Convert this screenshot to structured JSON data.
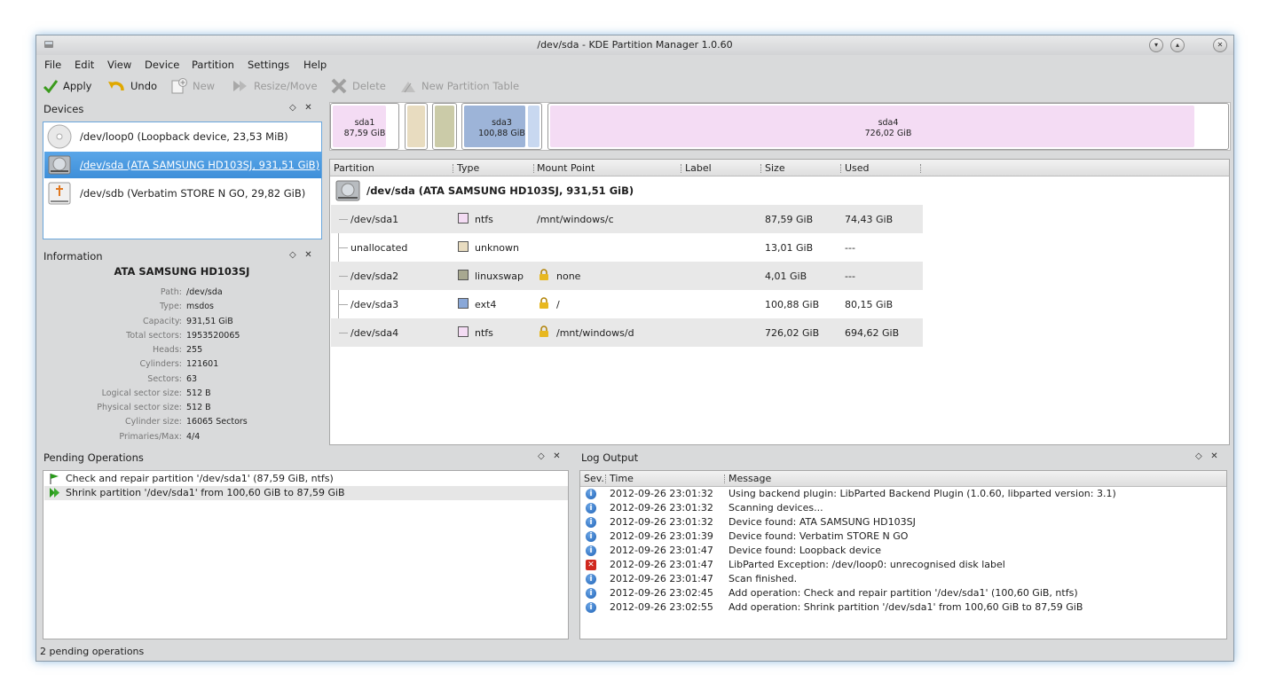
{
  "window": {
    "title": "/dev/sda - KDE Partition Manager 1.0.60"
  },
  "menu": [
    "File",
    "Edit",
    "View",
    "Device",
    "Partition",
    "Settings",
    "Help"
  ],
  "toolbar": {
    "apply": "Apply",
    "undo": "Undo",
    "new": "New",
    "resize": "Resize/Move",
    "delete": "Delete",
    "new_table": "New Partition Table"
  },
  "devices_panel": {
    "title": "Devices",
    "items": [
      {
        "label": "/dev/loop0 (Loopback device, 23,53 MiB)",
        "icon": "cdrom-icon"
      },
      {
        "label": "/dev/sda (ATA SAMSUNG HD103SJ, 931,51 GiB)",
        "icon": "harddisk-icon",
        "selected": true
      },
      {
        "label": "/dev/sdb (Verbatim STORE N GO, 29,82 GiB)",
        "icon": "usb-drive-icon"
      }
    ]
  },
  "info_panel": {
    "title": "Information",
    "heading": "ATA SAMSUNG HD103SJ",
    "rows": [
      {
        "k": "Path:",
        "v": "/dev/sda"
      },
      {
        "k": "Type:",
        "v": "msdos"
      },
      {
        "k": "Capacity:",
        "v": "931,51 GiB"
      },
      {
        "k": "Total sectors:",
        "v": "1953520065"
      },
      {
        "k": "Heads:",
        "v": "255"
      },
      {
        "k": "Cylinders:",
        "v": "121601"
      },
      {
        "k": "Sectors:",
        "v": "63"
      },
      {
        "k": "Logical sector size:",
        "v": "512 B"
      },
      {
        "k": "Physical sector size:",
        "v": "512 B"
      },
      {
        "k": "Cylinder size:",
        "v": "16065 Sectors"
      },
      {
        "k": "Primaries/Max:",
        "v": "4/4"
      }
    ]
  },
  "partition_bar": [
    {
      "name": "sda1",
      "size": "87,59 GiB",
      "fs": "ntfs",
      "color": "#f4dcf4"
    },
    {
      "name": "",
      "size": "",
      "fs": "unknown",
      "color": "#e8dcc0"
    },
    {
      "name": "",
      "size": "",
      "fs": "linuxswap",
      "color": "#c8c8a8"
    },
    {
      "name": "sda3",
      "size": "100,88 GiB",
      "fs": "ext4",
      "color": "#9db4d8"
    },
    {
      "name": "sda4",
      "size": "726,02 GiB",
      "fs": "ntfs",
      "color": "#f4dcf4"
    }
  ],
  "partition_table": {
    "headers": [
      "Partition",
      "Type",
      "Mount Point",
      "Label",
      "Size",
      "Used"
    ],
    "device": "/dev/sda (ATA SAMSUNG HD103SJ, 931,51 GiB)",
    "rows": [
      {
        "partition": "/dev/sda1",
        "type": "ntfs",
        "type_color": "#f4dcf4",
        "mount": "/mnt/windows/c",
        "locked": false,
        "label": "",
        "size": "87,59 GiB",
        "used": "74,43 GiB"
      },
      {
        "partition": "unallocated",
        "type": "unknown",
        "type_color": "#e8dcc0",
        "mount": "",
        "locked": false,
        "label": "",
        "size": "13,01 GiB",
        "used": "---"
      },
      {
        "partition": "/dev/sda2",
        "type": "linuxswap",
        "type_color": "#a8a890",
        "mount": "none",
        "locked": true,
        "label": "",
        "size": "4,01 GiB",
        "used": "---"
      },
      {
        "partition": "/dev/sda3",
        "type": "ext4",
        "type_color": "#8aa8d8",
        "mount": "/",
        "locked": true,
        "label": "",
        "size": "100,88 GiB",
        "used": "80,15 GiB"
      },
      {
        "partition": "/dev/sda4",
        "type": "ntfs",
        "type_color": "#f4dcf4",
        "mount": "/mnt/windows/d",
        "locked": true,
        "label": "",
        "size": "726,02 GiB",
        "used": "694,62 GiB"
      }
    ]
  },
  "pending_panel": {
    "title": "Pending Operations",
    "items": [
      "Check and repair partition '/dev/sda1' (87,59 GiB, ntfs)",
      "Shrink partition '/dev/sda1' from 100,60 GiB to 87,59 GiB"
    ]
  },
  "log_panel": {
    "title": "Log Output",
    "headers": [
      "Sev.",
      "Time",
      "Message"
    ],
    "rows": [
      {
        "sev": "info",
        "time": "2012-09-26 23:01:32",
        "msg": "Using backend plugin: LibParted Backend Plugin (1.0.60, libparted version: 3.1)"
      },
      {
        "sev": "info",
        "time": "2012-09-26 23:01:32",
        "msg": "Scanning devices..."
      },
      {
        "sev": "info",
        "time": "2012-09-26 23:01:32",
        "msg": "Device found: ATA SAMSUNG HD103SJ"
      },
      {
        "sev": "info",
        "time": "2012-09-26 23:01:39",
        "msg": "Device found: Verbatim STORE N GO"
      },
      {
        "sev": "info",
        "time": "2012-09-26 23:01:47",
        "msg": "Device found: Loopback device"
      },
      {
        "sev": "error",
        "time": "2012-09-26 23:01:47",
        "msg": "LibParted Exception: /dev/loop0: unrecognised disk label"
      },
      {
        "sev": "info",
        "time": "2012-09-26 23:01:47",
        "msg": "Scan finished."
      },
      {
        "sev": "info",
        "time": "2012-09-26 23:02:45",
        "msg": "Add operation: Check and repair partition '/dev/sda1' (100,60 GiB, ntfs)"
      },
      {
        "sev": "info",
        "time": "2012-09-26 23:02:55",
        "msg": "Add operation: Shrink partition '/dev/sda1' from 100,60 GiB to 87,59 GiB"
      }
    ]
  },
  "status": "2 pending operations"
}
